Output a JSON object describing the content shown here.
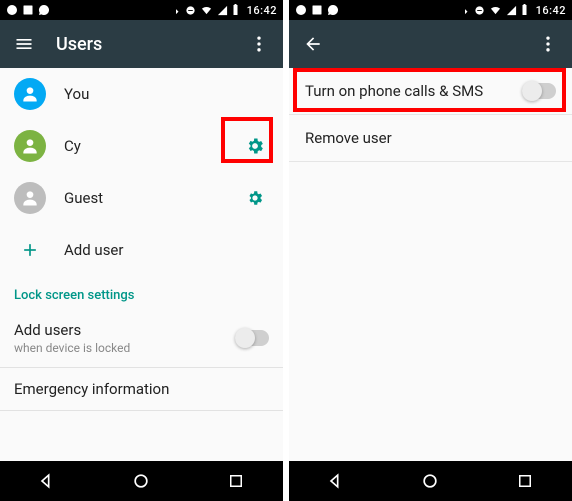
{
  "status": {
    "time": "16:42"
  },
  "left": {
    "appbar_title": "Users",
    "users": [
      {
        "name": "You",
        "avatar_color": "#03a9f4"
      },
      {
        "name": "Cy",
        "avatar_color": "#7cb342"
      },
      {
        "name": "Guest",
        "avatar_color": "#bdbdbd"
      }
    ],
    "add_user_label": "Add user",
    "section_lock": "Lock screen settings",
    "pref_addusers_title": "Add users",
    "pref_addusers_sub": "when device is locked",
    "emergency_label": "Emergency information"
  },
  "right": {
    "setting_phone_sms": "Turn on phone calls & SMS",
    "remove_user": "Remove user"
  }
}
